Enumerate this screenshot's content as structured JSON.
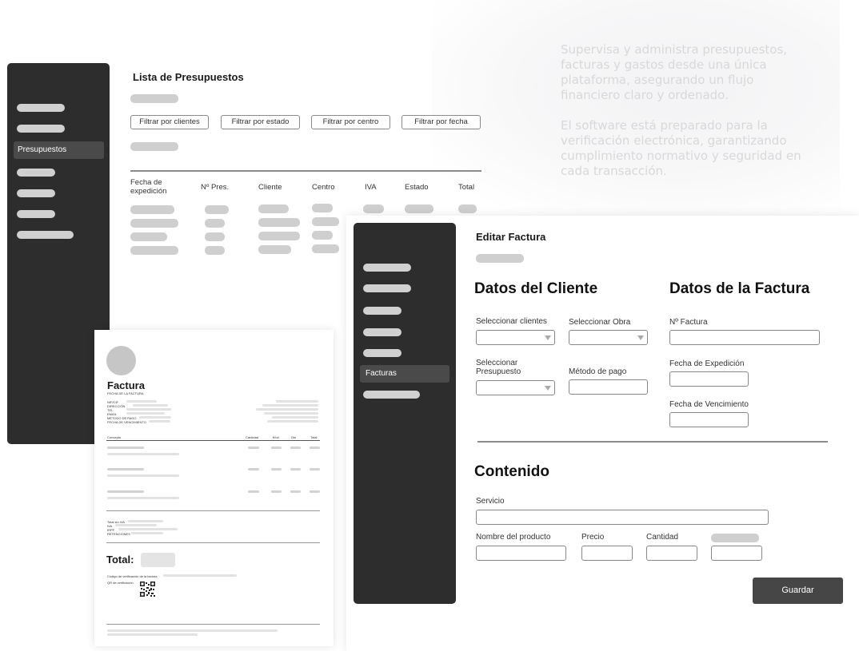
{
  "marketing": {
    "p1": "Supervisa y administra presupuestos, facturas y gastos desde una única plataforma, asegurando un flujo financiero claro y ordenado.",
    "p2": "El software está preparado para la verificación electrónica, garantizando cumplimiento normativo y seguridad en cada transacción."
  },
  "budget_list": {
    "sidebar_active": "Presupuestos",
    "title": "Lista de Presupuestos",
    "filters": [
      "Filtrar por clientes",
      "Filtrar por estado",
      "Filtrar por centro",
      "Filtrar por fecha"
    ],
    "columns": [
      "Fecha de expedición",
      "Nº Pres.",
      "Cliente",
      "Centro",
      "IVA",
      "Estado",
      "Total"
    ]
  },
  "invoice_doc": {
    "title": "Factura",
    "subtitle": "FECHA DE LA FACTURA",
    "fields": [
      "NIF/CIF",
      "DIRECCIÓN",
      "TEL",
      "EMAIL",
      "MÉTODO DE PAGO",
      "FECHA DE VENCIMIENTO"
    ],
    "table_headers": [
      "Concepto",
      "Cantidad",
      "€/ud",
      "Dto",
      "Total"
    ],
    "totals_labels": [
      "Total sin IVA",
      "IVA",
      "IRPF",
      "RETENCIONES"
    ],
    "total_label": "Total:",
    "verification_label": "Código de verificación de la factura",
    "qr_label": "QR de verificación"
  },
  "edit_invoice": {
    "sidebar_active": "Facturas",
    "title": "Editar Factura",
    "client_section": "Datos del Cliente",
    "invoice_section": "Datos de la Factura",
    "select_clients": "Seleccionar clientes",
    "select_work": "Seleccionar Obra",
    "select_budget": "Seleccionar Presupuesto",
    "payment_method": "Método de pago",
    "invoice_number": "Nº Factura",
    "issue_date": "Fecha de Expedición",
    "due_date": "Fecha de Vencimiento",
    "content_section": "Contenido",
    "service": "Servicio",
    "product_name": "Nombre del producto",
    "price": "Precio",
    "quantity": "Cantidad",
    "save": "Guardar"
  }
}
